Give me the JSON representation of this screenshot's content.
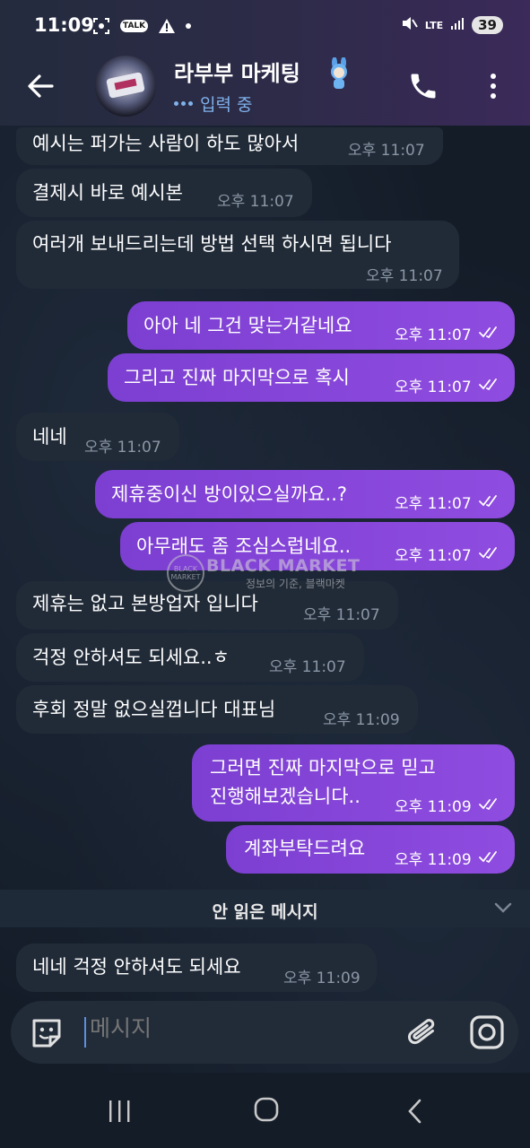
{
  "status_bar": {
    "time": "11:09",
    "talk_badge": "TALK",
    "network": "LTE",
    "battery": "39"
  },
  "header": {
    "title": "라부부 마케팅",
    "subtitle": "입력 중"
  },
  "messages": [
    {
      "dir": "in",
      "text": "예시는 퍼가는 사람이 하도 많아서",
      "time": "오후 11:07"
    },
    {
      "dir": "in",
      "text": "결제시 바로 예시본",
      "time": "오후 11:07"
    },
    {
      "dir": "in",
      "text": "여러개 보내드리는데 방법 선택 하시면 됩니다",
      "time": "오후 11:07"
    },
    {
      "dir": "out",
      "text": "아아 네 그건 맞는거같네요",
      "time": "오후 11:07"
    },
    {
      "dir": "out",
      "text": "그리고 진짜 마지막으로 혹시",
      "time": "오후 11:07"
    },
    {
      "dir": "in",
      "text": "네네",
      "time": "오후 11:07"
    },
    {
      "dir": "out",
      "text": "제휴중이신 방이있으실까요..?",
      "time": "오후 11:07"
    },
    {
      "dir": "out",
      "text": "아무래도 좀 조심스럽네요..",
      "time": "오후 11:07"
    },
    {
      "dir": "in",
      "text": "제휴는 없고 본방업자 입니다",
      "time": "오후 11:07"
    },
    {
      "dir": "in",
      "text": "걱정 안하셔도 되세요..ㅎ",
      "time": "오후 11:07"
    },
    {
      "dir": "in",
      "text": "후회 정말 없으실껍니다 대표님",
      "time": "오후 11:09"
    },
    {
      "dir": "out",
      "text": "그러면 진짜 마지막으로 믿고",
      "text2": "진행해보겠습니다..",
      "time": "오후 11:09"
    },
    {
      "dir": "out",
      "text": "계좌부탁드려요",
      "time": "오후 11:09"
    },
    {
      "dir": "in",
      "text": "네네 걱정 안하셔도 되세요",
      "time": "오후 11:09"
    }
  ],
  "watermark": {
    "logo_text": "BLACK MARKET",
    "title": "BLACK MARKET",
    "subtitle": "정보의 기준, 블랙마켓"
  },
  "unread_divider": "안 읽은 메시지",
  "composer": {
    "placeholder": "메시지"
  },
  "icons": [
    "back-arrow-icon",
    "phone-icon",
    "more-vertical-icon",
    "sticker-icon",
    "paperclip-icon",
    "camera-icon",
    "double-check-icon",
    "chevron-down-icon"
  ],
  "colors": {
    "outgoing_bubble": "#8544d9",
    "incoming_bubble": "#212b38",
    "typing_accent": "#7fb1ea",
    "background": "#141c28"
  }
}
